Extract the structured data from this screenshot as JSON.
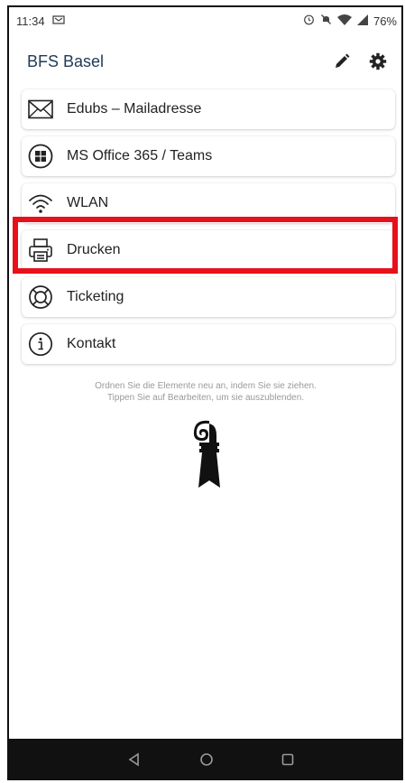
{
  "status_bar": {
    "time": "11:34",
    "battery": "76%"
  },
  "app_bar": {
    "title": "BFS Basel"
  },
  "menu": {
    "items": [
      {
        "label": "Edubs – Mailadresse",
        "icon": "mail-icon"
      },
      {
        "label": "MS Office 365 / Teams",
        "icon": "windows-icon"
      },
      {
        "label": "WLAN",
        "icon": "wifi-icon"
      },
      {
        "label": "Drucken",
        "icon": "printer-icon"
      },
      {
        "label": "Ticketing",
        "icon": "lifebuoy-icon"
      },
      {
        "label": "Kontakt",
        "icon": "info-icon"
      }
    ]
  },
  "hint": {
    "line1": "Ordnen Sie die Elemente neu an, indem Sie sie ziehen.",
    "line2": "Tippen Sie auf Bearbeiten, um sie auszublenden."
  },
  "colors": {
    "title": "#1f3a57",
    "highlight": "#e8101a",
    "nav_bar": "#111111"
  }
}
